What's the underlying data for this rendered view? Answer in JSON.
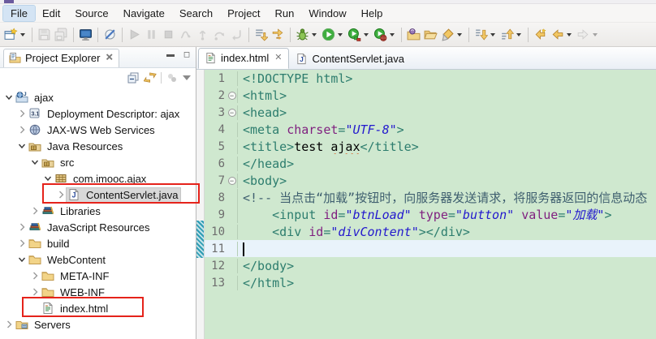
{
  "menubar": {
    "items": [
      "File",
      "Edit",
      "Source",
      "Navigate",
      "Search",
      "Project",
      "Run",
      "Window",
      "Help"
    ],
    "active": "File"
  },
  "toolbar": {
    "groups": [
      [
        {
          "icon": "new-wizard",
          "dd": true
        }
      ],
      [
        {
          "icon": "save",
          "disabled": true
        },
        {
          "icon": "save-all",
          "disabled": true
        }
      ],
      [
        {
          "icon": "console"
        }
      ],
      [
        {
          "icon": "skip-breakpoints"
        }
      ],
      [
        {
          "icon": "resume",
          "disabled": true
        },
        {
          "icon": "suspend",
          "disabled": true
        },
        {
          "icon": "terminate",
          "disabled": true
        },
        {
          "icon": "disconnect",
          "disabled": true
        },
        {
          "icon": "step-into",
          "disabled": true
        },
        {
          "icon": "step-over",
          "disabled": true
        },
        {
          "icon": "step-return",
          "disabled": true
        }
      ],
      [
        {
          "icon": "drop-to-frame"
        },
        {
          "icon": "use-step-filters"
        }
      ],
      [
        {
          "icon": "debug",
          "dd": true
        },
        {
          "icon": "run",
          "dd": true
        },
        {
          "icon": "coverage",
          "dd": true
        },
        {
          "icon": "profile",
          "dd": true
        }
      ],
      [
        {
          "icon": "open-type"
        },
        {
          "icon": "open-resource"
        },
        {
          "icon": "highlighter",
          "dd": true
        }
      ],
      [
        {
          "icon": "next-annotation",
          "dd": true
        },
        {
          "icon": "previous-annotation",
          "dd": true
        }
      ],
      [
        {
          "icon": "last-edit-location"
        },
        {
          "icon": "back",
          "dd": true
        },
        {
          "icon": "forward",
          "dd": true,
          "disabled": true
        }
      ]
    ]
  },
  "sidebar": {
    "title": "Project Explorer",
    "toolbar_icons": [
      "collapse-all",
      "link-with-editor"
    ],
    "tree": [
      {
        "label": "ajax",
        "icon": "web-project",
        "indent": 0,
        "expanded": true
      },
      {
        "label": "Deployment Descriptor: ajax",
        "icon": "deployment-descriptor",
        "indent": 1,
        "expanded": false
      },
      {
        "label": "JAX-WS Web Services",
        "icon": "jaxws",
        "indent": 1,
        "expanded": false
      },
      {
        "label": "Java Resources",
        "icon": "java-resources",
        "indent": 1,
        "expanded": true
      },
      {
        "label": "src",
        "icon": "src-folder",
        "indent": 2,
        "expanded": true
      },
      {
        "label": "com.imooc.ajax",
        "icon": "package",
        "indent": 3,
        "expanded": true
      },
      {
        "label": "ContentServlet.java",
        "icon": "java-file",
        "indent": 4,
        "expanded": false,
        "selected": true
      },
      {
        "label": "Libraries",
        "icon": "libraries",
        "indent": 2,
        "expanded": false
      },
      {
        "label": "JavaScript Resources",
        "icon": "libraries",
        "indent": 1,
        "expanded": false
      },
      {
        "label": "build",
        "icon": "folder",
        "indent": 1,
        "expanded": false
      },
      {
        "label": "WebContent",
        "icon": "folder",
        "indent": 1,
        "expanded": true
      },
      {
        "label": "META-INF",
        "icon": "folder",
        "indent": 2,
        "expanded": false
      },
      {
        "label": "WEB-INF",
        "icon": "folder",
        "indent": 2,
        "expanded": false
      },
      {
        "label": "index.html",
        "icon": "html-file",
        "indent": 2,
        "expanded": null
      },
      {
        "label": "Servers",
        "icon": "servers-folder",
        "indent": 0,
        "expanded": false
      }
    ]
  },
  "editor": {
    "tabs": [
      {
        "label": "index.html",
        "icon": "html-file",
        "active": true,
        "closable": true
      },
      {
        "label": "ContentServlet.java",
        "icon": "java-file",
        "active": false,
        "closable": false
      }
    ],
    "lines": [
      {
        "n": 1,
        "segs": [
          {
            "c": "tag",
            "t": "<!DOCTYPE html>"
          }
        ]
      },
      {
        "n": 2,
        "fold": true,
        "segs": [
          {
            "c": "tag",
            "t": "<html>"
          }
        ]
      },
      {
        "n": 3,
        "fold": true,
        "segs": [
          {
            "c": "tag",
            "t": "<head>"
          }
        ]
      },
      {
        "n": 4,
        "segs": [
          {
            "c": "tag",
            "t": "<meta "
          },
          {
            "c": "attr",
            "t": "charset"
          },
          {
            "c": "tag",
            "t": "="
          },
          {
            "c": "str",
            "t": "\"UTF-8\""
          },
          {
            "c": "tag",
            "t": ">"
          }
        ]
      },
      {
        "n": 5,
        "segs": [
          {
            "c": "tag",
            "t": "<title>"
          },
          {
            "c": "text",
            "t": "test "
          },
          {
            "c": "text misspell",
            "t": "ajax"
          },
          {
            "c": "tag",
            "t": "</title>"
          }
        ]
      },
      {
        "n": 6,
        "segs": [
          {
            "c": "tag",
            "t": "</head>"
          }
        ]
      },
      {
        "n": 7,
        "fold": true,
        "segs": [
          {
            "c": "tag",
            "t": "<body>"
          }
        ]
      },
      {
        "n": 8,
        "segs": [
          {
            "c": "comment",
            "t": "<!-- 当点击“加载”按钮时，向服务器发送请求，将服务器返回的信息动态"
          }
        ]
      },
      {
        "n": 9,
        "segs": [
          {
            "c": "tag",
            "t": "    <input "
          },
          {
            "c": "attr",
            "t": "id"
          },
          {
            "c": "tag",
            "t": "="
          },
          {
            "c": "str",
            "t": "\"btnLoad\""
          },
          {
            "c": "tag",
            "t": " "
          },
          {
            "c": "attr",
            "t": "type"
          },
          {
            "c": "tag",
            "t": "="
          },
          {
            "c": "str",
            "t": "\"button\""
          },
          {
            "c": "tag",
            "t": " "
          },
          {
            "c": "attr",
            "t": "value"
          },
          {
            "c": "tag",
            "t": "="
          },
          {
            "c": "str",
            "t": "\"加载\""
          },
          {
            "c": "tag",
            "t": ">"
          }
        ]
      },
      {
        "n": 10,
        "marker": true,
        "segs": [
          {
            "c": "tag",
            "t": "    <div "
          },
          {
            "c": "attr",
            "t": "id"
          },
          {
            "c": "tag",
            "t": "="
          },
          {
            "c": "str",
            "t": "\"divContent\""
          },
          {
            "c": "tag",
            "t": "></div>"
          }
        ]
      },
      {
        "n": 11,
        "marker": true,
        "current": true,
        "cursor": true,
        "segs": []
      },
      {
        "n": 12,
        "segs": [
          {
            "c": "tag",
            "t": "</body>"
          }
        ]
      },
      {
        "n": 13,
        "segs": [
          {
            "c": "tag",
            "t": "</html>"
          }
        ]
      }
    ]
  },
  "colors": {
    "editor_background": "#cfe8cf",
    "tag": "#2d7d6e",
    "attribute": "#7f1f7f",
    "string": "#2319ce",
    "comment": "#3f5f6f",
    "annotation_red": "#e5231b",
    "current_line": "#e9f3fb"
  }
}
